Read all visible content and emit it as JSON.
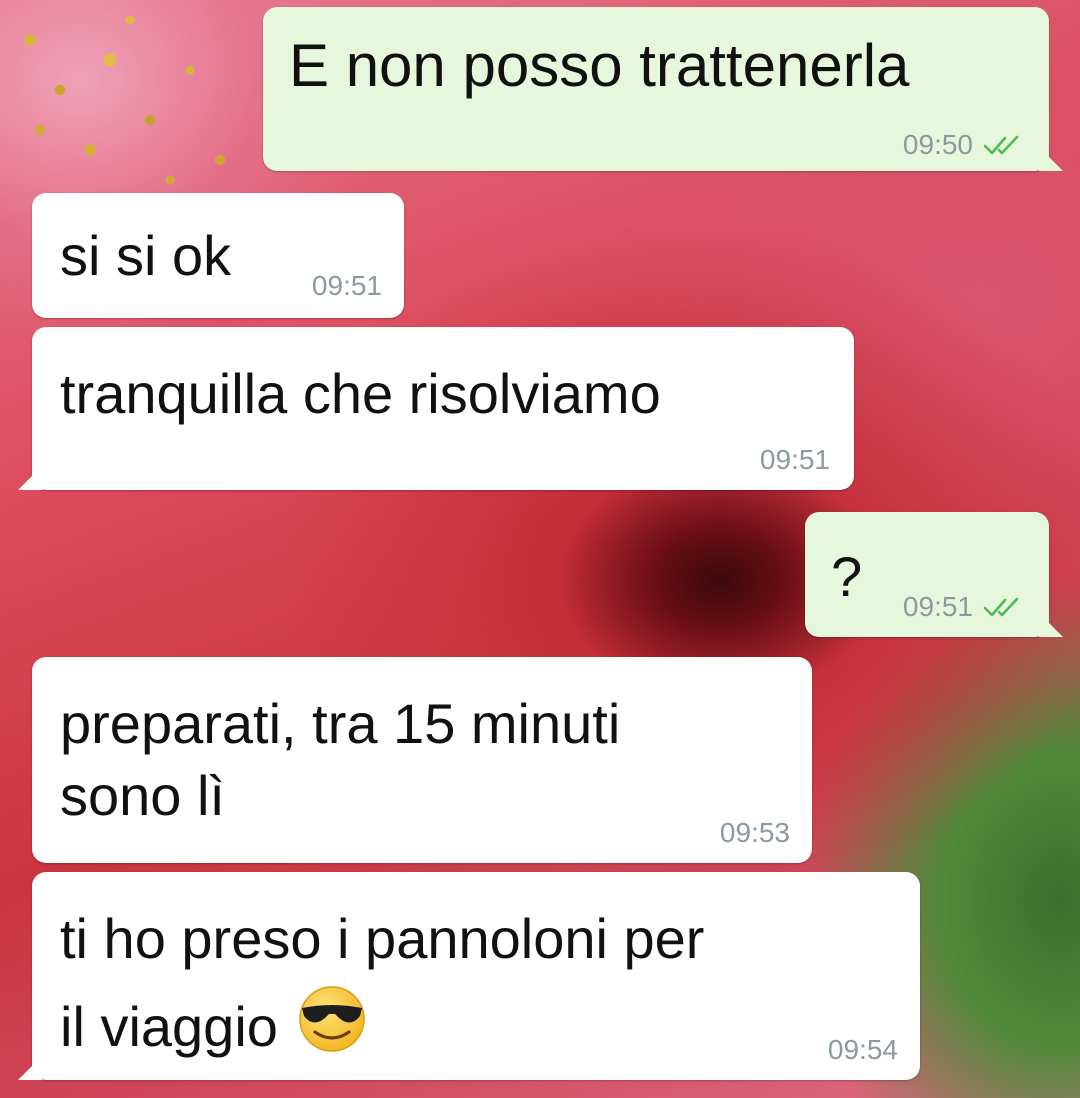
{
  "messages": [
    {
      "text": "E non posso trattenerla",
      "time": "09:50",
      "direction": "outgoing",
      "status": "read"
    },
    {
      "text": "si si ok",
      "time": "09:51",
      "direction": "incoming"
    },
    {
      "text": "tranquilla che risolviamo",
      "time": "09:51",
      "direction": "incoming"
    },
    {
      "text": "?",
      "time": "09:51",
      "direction": "outgoing",
      "status": "read"
    },
    {
      "lines": [
        "preparati, tra 15 minuti",
        "sono lì"
      ],
      "time": "09:53",
      "direction": "incoming"
    },
    {
      "lines": [
        "ti ho preso i pannoloni per",
        "il viaggio"
      ],
      "emoji": "smiling-face-with-sunglasses",
      "time": "09:54",
      "direction": "incoming"
    }
  ],
  "colors": {
    "incoming_bubble": "#ffffff",
    "outgoing_bubble": "#e7f7dd",
    "read_ticks": "#4fbb54",
    "timestamp": "#8c9aa0"
  },
  "icons": {
    "read_status": "double-check-icon"
  }
}
